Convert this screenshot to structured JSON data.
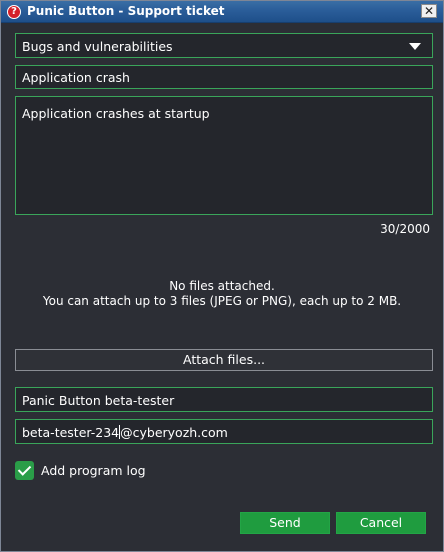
{
  "window": {
    "title": "Punic Button - Support ticket",
    "icon": "question-mark-icon",
    "icon_glyph": "?",
    "close_glyph": "✕"
  },
  "form": {
    "category": {
      "selected": "Bugs and vulnerabilities"
    },
    "subject": {
      "value": "Application crash"
    },
    "description": {
      "value": "Application crashes at startup"
    },
    "char_counter": "30/2000",
    "attachments": {
      "status": "No files attached.",
      "hint": "You can attach up to 3 files (JPEG or PNG), each up to 2 MB.",
      "attach_button": "Attach files..."
    },
    "name": {
      "value": "Panic Button beta-tester"
    },
    "email": {
      "value_before_cursor": "beta-tester-234",
      "value_after_cursor": "@cyberyozh.com"
    },
    "program_log": {
      "label": "Add program log",
      "checked": true
    }
  },
  "buttons": {
    "send": "Send",
    "cancel": "Cancel"
  },
  "colors": {
    "accent_green": "#1f9c3f",
    "field_border": "#3aa55a",
    "background": "#2c2e35",
    "titlebar": "#2a5d99"
  }
}
